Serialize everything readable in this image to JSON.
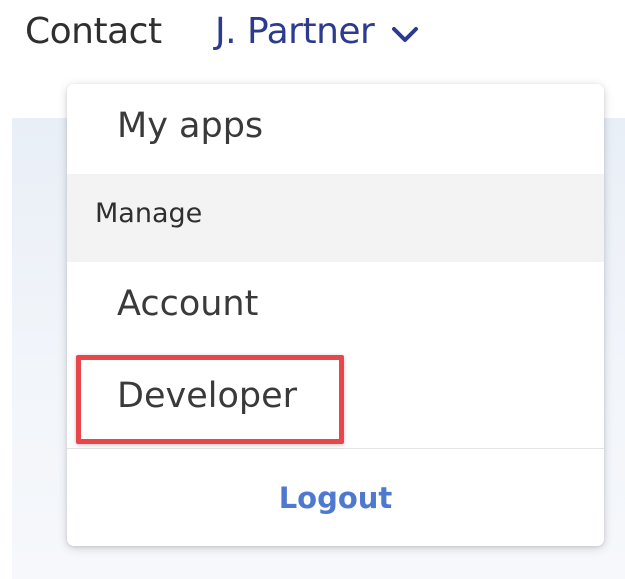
{
  "nav": {
    "contact": "Contact",
    "user_name": "J. Partner"
  },
  "dropdown": {
    "items": [
      {
        "label": "My apps"
      },
      {
        "label": "Account"
      },
      {
        "label": "Developer"
      }
    ],
    "section_label": "Manage",
    "logout_label": "Logout"
  },
  "icons": {
    "user_menu": "chevron-down-icon"
  },
  "colors": {
    "user_name": "#2c3b8f",
    "logout": "#4f79cf",
    "highlight": "#e8464a",
    "section_bg": "#f3f3f3"
  }
}
